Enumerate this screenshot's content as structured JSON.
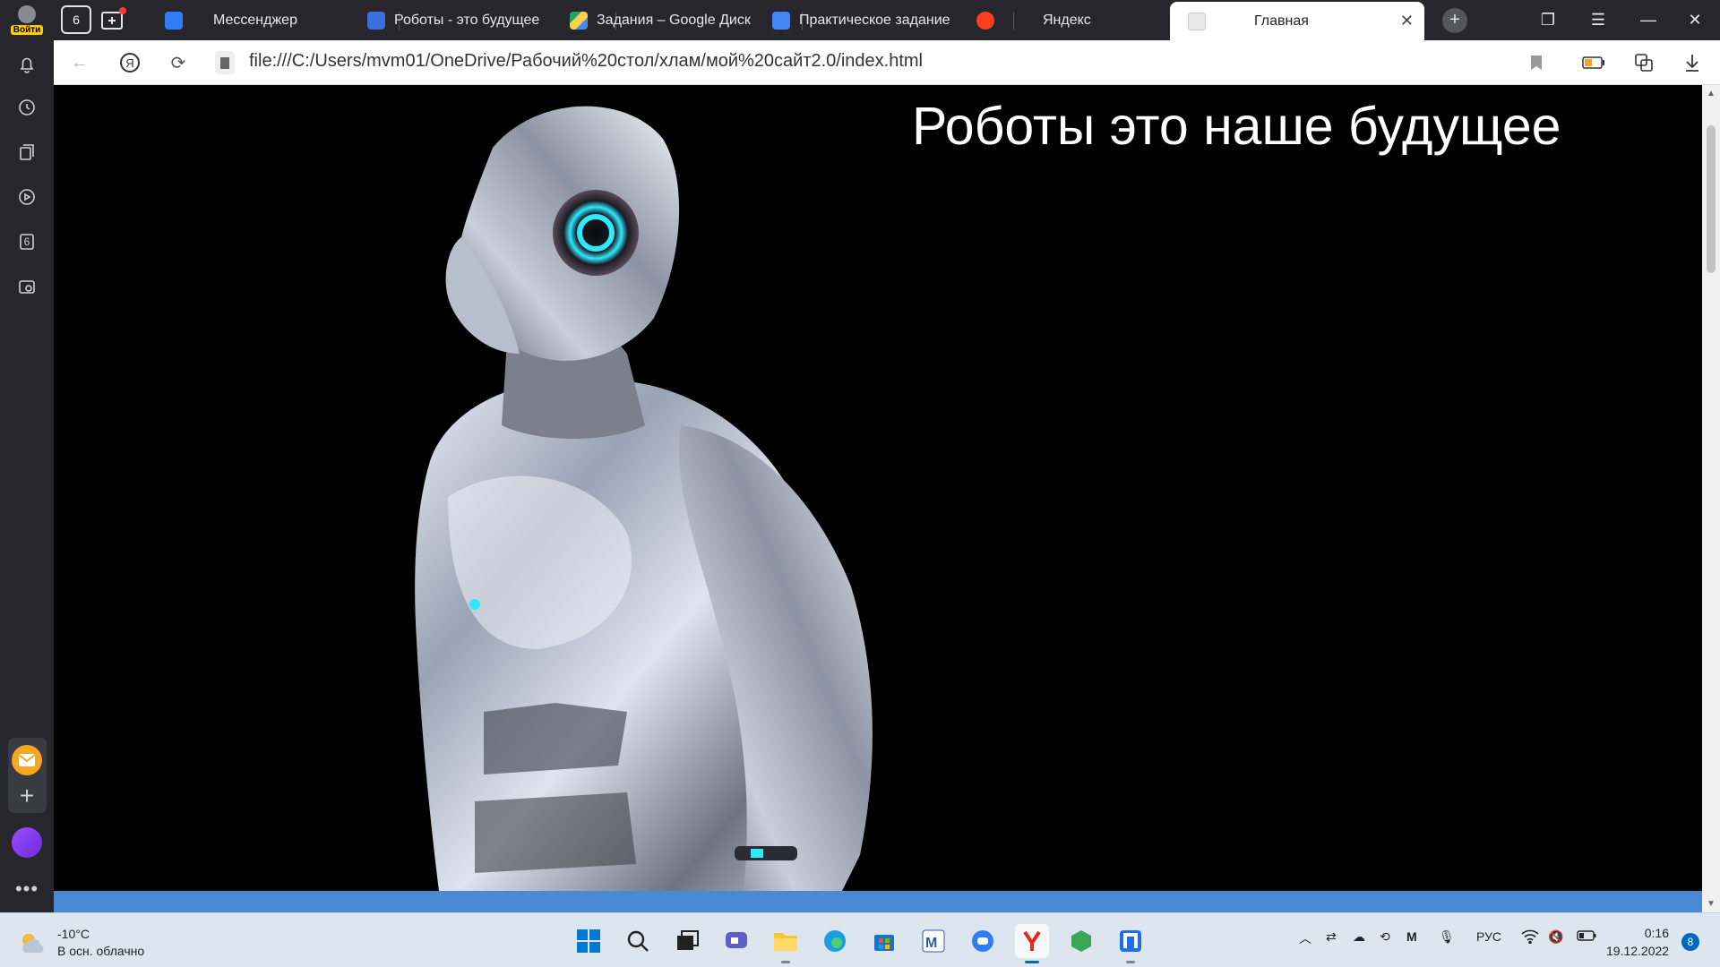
{
  "browser": {
    "login_label": "Войти",
    "home_tab_count": "6",
    "tabs": [
      {
        "title": "Мессенджер",
        "favicon": "messenger-icon",
        "color": "#2f7cf6"
      },
      {
        "title": "Роботы - это будущее",
        "favicon": "pencil-p-icon",
        "color": "#3a6fe0"
      },
      {
        "title": "Задания – Google Диск",
        "favicon": "google-drive-icon",
        "color": "#1fa463"
      },
      {
        "title": "Практическое задание",
        "favicon": "google-docs-icon",
        "color": "#4285f4"
      },
      {
        "title": "Яндекс",
        "favicon": "yandex-icon",
        "color": "#fc3f1d"
      },
      {
        "title": "Главная",
        "favicon": "file-icon",
        "color": "#cccccc",
        "active": true
      }
    ],
    "url": "file:///C:/Users/mvm01/OneDrive/Рабочий%20стол/хлам/мой%20сайт2.0/index.html",
    "sidebar_badge": "6"
  },
  "page": {
    "heading": "Роботы это наше будущее",
    "hero_image": "chrome-humanoid-robot-illustration",
    "background": "#000000",
    "footer_color": "#4a8ad4"
  },
  "taskbar": {
    "weather_temp": "-10°C",
    "weather_desc": "В осн. облачно",
    "language": "РУС",
    "time": "0:16",
    "date": "19.12.2022",
    "notifications": "8"
  }
}
